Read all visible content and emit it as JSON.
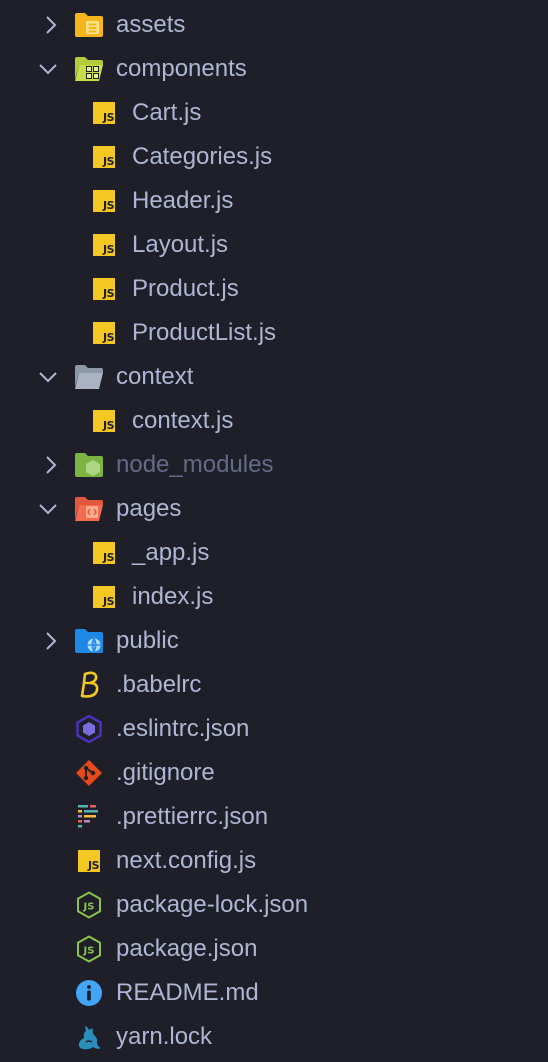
{
  "colors": {
    "background": "#1e1f29",
    "text": "#aeb6d2",
    "text_dim": "#646b87",
    "chevron": "#aeb6d2",
    "js_yellow": "#f5c722"
  },
  "tree": {
    "assets": {
      "label": "assets",
      "icon": "folder-assets-icon",
      "expanded": false
    },
    "components": {
      "label": "components",
      "icon": "folder-components-icon",
      "expanded": true
    },
    "cart": {
      "label": "Cart.js",
      "icon": "javascript-icon"
    },
    "categories": {
      "label": "Categories.js",
      "icon": "javascript-icon"
    },
    "header": {
      "label": "Header.js",
      "icon": "javascript-icon"
    },
    "layout": {
      "label": "Layout.js",
      "icon": "javascript-icon"
    },
    "product": {
      "label": "Product.js",
      "icon": "javascript-icon"
    },
    "productlist": {
      "label": "ProductList.js",
      "icon": "javascript-icon"
    },
    "context_folder": {
      "label": "context",
      "icon": "folder-context-icon",
      "expanded": true
    },
    "context_file": {
      "label": "context.js",
      "icon": "javascript-icon"
    },
    "node_modules": {
      "label": "node_modules",
      "icon": "folder-node-icon",
      "expanded": false
    },
    "pages": {
      "label": "pages",
      "icon": "folder-pages-icon",
      "expanded": true
    },
    "app": {
      "label": "_app.js",
      "icon": "javascript-icon"
    },
    "index": {
      "label": "index.js",
      "icon": "javascript-icon"
    },
    "public": {
      "label": "public",
      "icon": "folder-public-icon",
      "expanded": false
    },
    "babelrc": {
      "label": ".babelrc",
      "icon": "babel-icon"
    },
    "eslintrc": {
      "label": ".eslintrc.json",
      "icon": "eslint-icon"
    },
    "gitignore": {
      "label": ".gitignore",
      "icon": "git-icon"
    },
    "prettierrc": {
      "label": ".prettierrc.json",
      "icon": "prettier-icon"
    },
    "nextconfig": {
      "label": "next.config.js",
      "icon": "javascript-icon"
    },
    "packagelock": {
      "label": "package-lock.json",
      "icon": "nodejs-icon"
    },
    "package": {
      "label": "package.json",
      "icon": "nodejs-icon"
    },
    "readme": {
      "label": "README.md",
      "icon": "info-icon"
    },
    "yarnlock": {
      "label": "yarn.lock",
      "icon": "yarn-icon"
    }
  }
}
